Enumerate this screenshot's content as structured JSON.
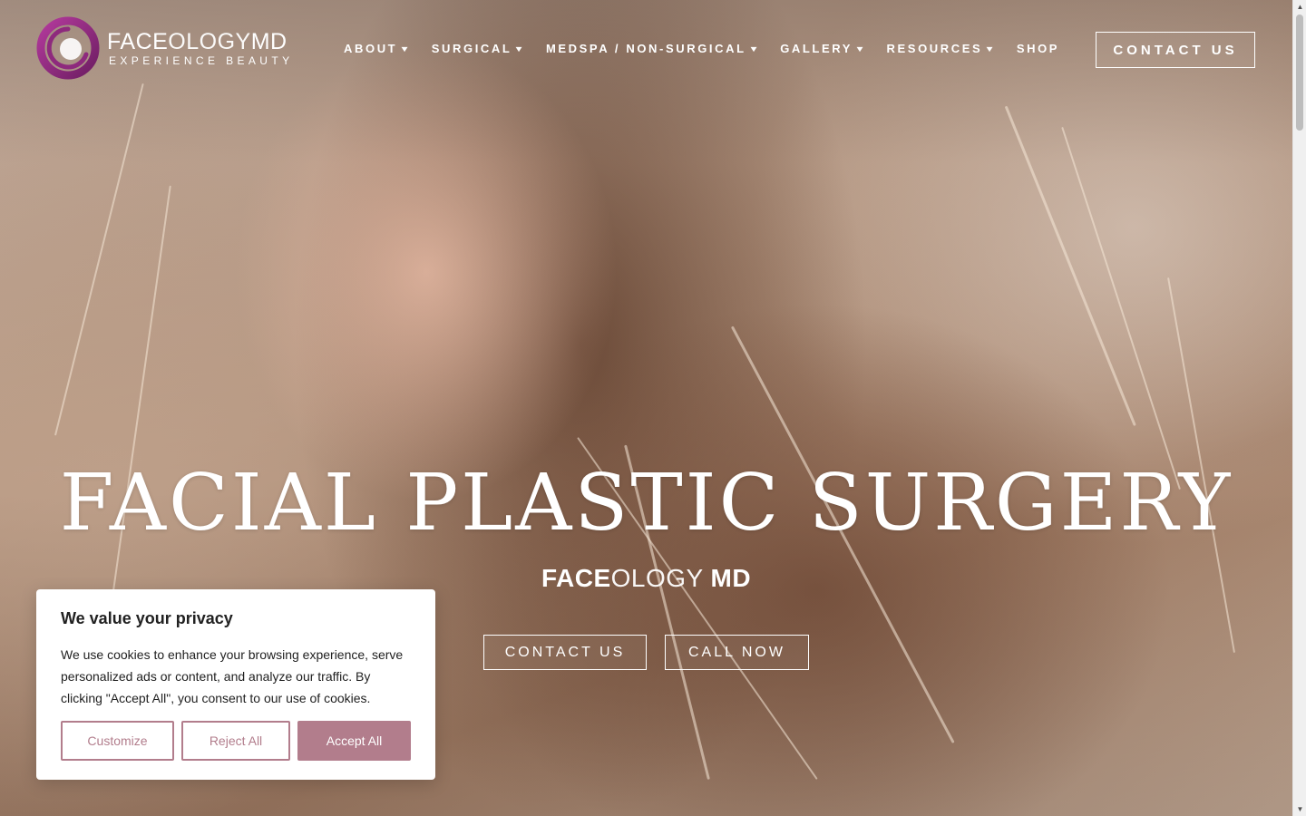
{
  "brand": {
    "name_bold": "FACE",
    "name_light": "OLOGY",
    "name_suffix": "MD",
    "tagline": "EXPERIENCE BEAUTY",
    "logo_icon": "swirl-ring-icon",
    "accent": "#8e2a7d"
  },
  "nav": {
    "items": [
      {
        "label": "ABOUT",
        "dropdown": true
      },
      {
        "label": "SURGICAL",
        "dropdown": true
      },
      {
        "label": "MEDSPA / NON-SURGICAL",
        "dropdown": true
      },
      {
        "label": "GALLERY",
        "dropdown": true
      },
      {
        "label": "RESOURCES",
        "dropdown": true
      },
      {
        "label": "SHOP",
        "dropdown": false
      }
    ],
    "contact_label": "CONTACT US"
  },
  "hero": {
    "headline": "FACIAL PLASTIC SURGERY",
    "sub_bold": "FACE",
    "sub_light": "OLOGY",
    "sub_suffix": "MD",
    "cta_contact": "CONTACT US",
    "cta_call": "CALL NOW"
  },
  "cookie": {
    "title": "We value your privacy",
    "body": "We use cookies to enhance your browsing experience, serve personalized ads or content, and analyze our traffic. By clicking \"Accept All\", you consent to our use of cookies.",
    "customize": "Customize",
    "reject": "Reject All",
    "accept": "Accept All",
    "accent": "#b27d8c"
  }
}
